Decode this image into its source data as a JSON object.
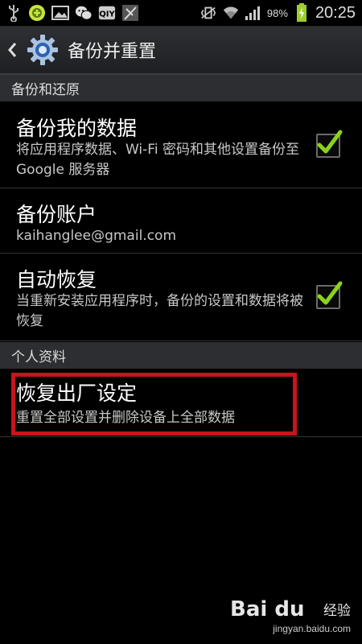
{
  "status_bar": {
    "battery_percent": "98%",
    "time": "20:25",
    "icons_left": [
      "usb-icon",
      "green-app-icon",
      "image-icon",
      "wechat-icon",
      "iqiyi-icon",
      "flag-icon"
    ],
    "icons_right": [
      "vibrate-icon",
      "wifi-icon",
      "signal-icon",
      "battery-icon"
    ]
  },
  "action_bar": {
    "title": "备份并重置"
  },
  "sections": [
    {
      "label": "备份和还原"
    },
    {
      "label": "个人资料"
    }
  ],
  "items": {
    "backup_data": {
      "title": "备份我的数据",
      "subtitle": "将应用程序数据、Wi-Fi 密码和其他设置备份至 Google 服务器",
      "checked": true
    },
    "backup_account": {
      "title": "备份账户",
      "subtitle": "kaihanglee@gmail.com"
    },
    "auto_restore": {
      "title": "自动恢复",
      "subtitle": "当重新安装应用程序时，备份的设置和数据将被恢复",
      "checked": true
    },
    "factory_reset": {
      "title": "恢复出厂设定",
      "subtitle": "重置全部设置并删除设备上全部数据"
    }
  },
  "colors": {
    "highlight_border": "#c8141b",
    "check_green": "#8bd31a",
    "section_bg": "#2c2e31"
  },
  "watermark": {
    "brand": "Bai du",
    "label": "经验",
    "url": "jingyan.baidu.com"
  }
}
